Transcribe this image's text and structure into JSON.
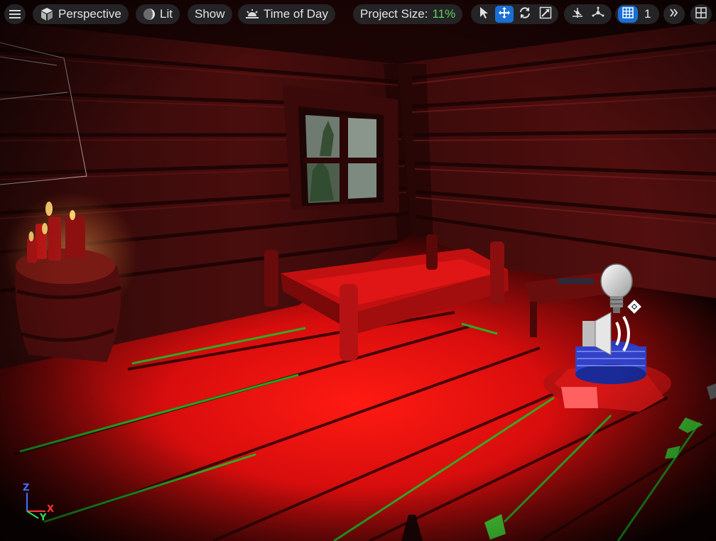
{
  "toolbar": {
    "menu_icon": "hamburger-menu-icon",
    "view_mode": "Perspective",
    "lighting_mode": "Lit",
    "show_label": "Show",
    "time_of_day_label": "Time of Day",
    "project_size_label": "Project Size:",
    "project_size_value": "11%",
    "project_size_color": "#5fd35f",
    "transform_tools": [
      "select-arrow-icon",
      "translate-icon",
      "rotate-icon",
      "scale-icon"
    ],
    "active_tool": "translate-icon",
    "snap_tools": [
      "surface-snapping-icon",
      "world-local-icon"
    ],
    "grid_snap_value": "1",
    "accent_color": "#1a6fd6"
  },
  "viewport": {
    "scene": "wooden cabin interior with bed, window, candles on barrel",
    "gizmos": [
      "point-light-icon",
      "audio-speaker-icon",
      "move-handle-icon"
    ],
    "axis_labels": {
      "x": "X",
      "y": "Y",
      "z": "Z"
    }
  }
}
